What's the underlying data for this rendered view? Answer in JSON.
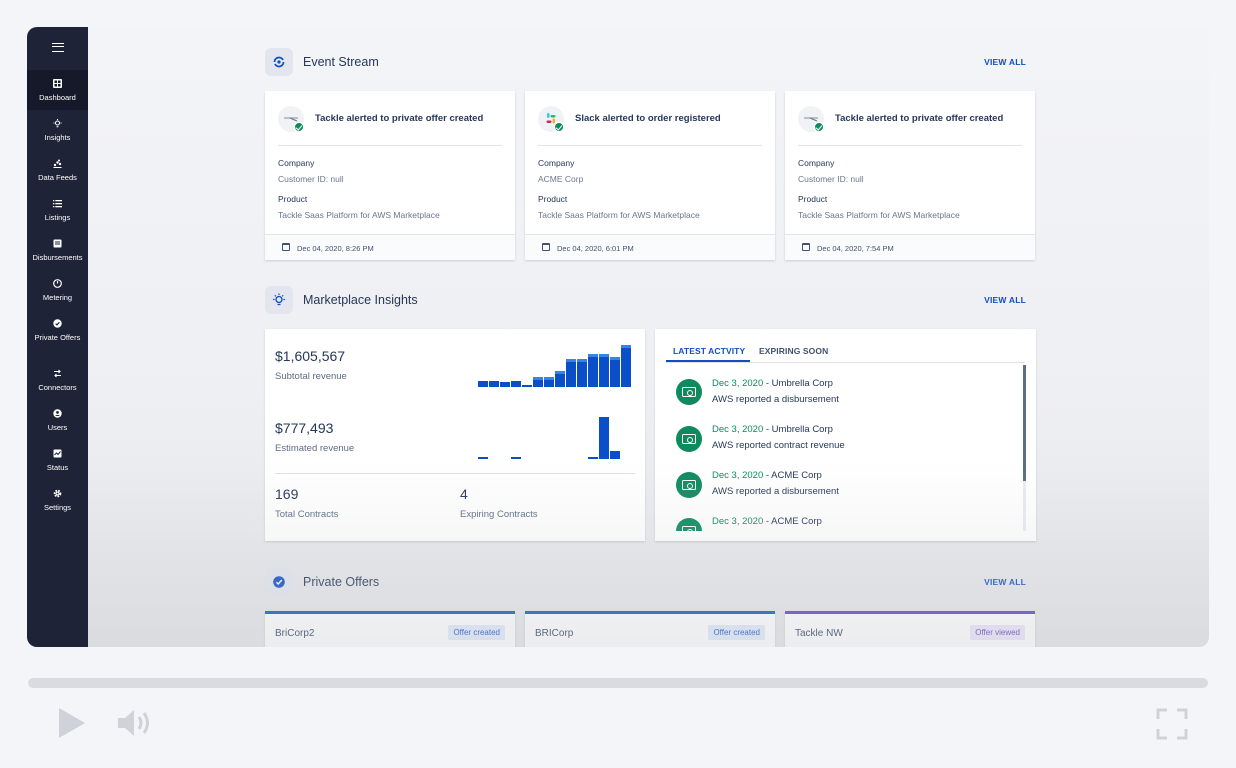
{
  "sidebar": {
    "items": [
      {
        "label": "Dashboard",
        "icon": "dashboard-icon"
      },
      {
        "label": "Insights",
        "icon": "lightbulb-icon"
      },
      {
        "label": "Data Feeds",
        "icon": "data-feeds-icon"
      },
      {
        "label": "Listings",
        "icon": "list-icon"
      },
      {
        "label": "Disbursements",
        "icon": "receipt-icon"
      },
      {
        "label": "Metering",
        "icon": "meter-icon"
      },
      {
        "label": "Private Offers",
        "icon": "badge-icon"
      },
      {
        "label": "Connectors",
        "icon": "connector-icon"
      },
      {
        "label": "Users",
        "icon": "user-icon"
      },
      {
        "label": "Status",
        "icon": "status-icon"
      },
      {
        "label": "Settings",
        "icon": "gear-icon"
      }
    ]
  },
  "event_stream": {
    "title": "Event Stream",
    "view_all": "VIEW ALL",
    "cards": [
      {
        "title": "Tackle alerted to private offer created",
        "company_label": "Company",
        "company": "Customer ID: null",
        "product_label": "Product",
        "product": "Tackle Saas Platform for AWS Marketplace",
        "date": "Dec 04, 2020, 8:26 PM",
        "logo": "tackle-logo"
      },
      {
        "title": "Slack alerted to order registered",
        "company_label": "Company",
        "company": "ACME Corp",
        "product_label": "Product",
        "product": "Tackle Saas Platform for AWS Marketplace",
        "date": "Dec 04, 2020, 6:01 PM",
        "logo": "slack-logo"
      },
      {
        "title": "Tackle alerted to private offer created",
        "company_label": "Company",
        "company": "Customer ID: null",
        "product_label": "Product",
        "product": "Tackle Saas Platform for AWS Marketplace",
        "date": "Dec 04, 2020, 7:54 PM",
        "logo": "tackle-logo"
      }
    ]
  },
  "insights": {
    "title": "Marketplace Insights",
    "view_all": "VIEW ALL",
    "subtotal_value": "$1,605,567",
    "subtotal_label": "Subtotal revenue",
    "estimated_value": "$777,493",
    "estimated_label": "Estimated revenue",
    "total_contracts_value": "169",
    "total_contracts_label": "Total Contracts",
    "expiring_value": "4",
    "expiring_label": "Expiring Contracts",
    "subtotal_sparkline": [
      0.15,
      0.15,
      0.12,
      0.15,
      0.03,
      0.24,
      0.24,
      0.38,
      0.67,
      0.67,
      0.79,
      0.79,
      0.71,
      1.0
    ],
    "estimated_sparkline": [
      0.05,
      0,
      0,
      0.05,
      0,
      0,
      0,
      0,
      0,
      0,
      0.05,
      1.0,
      0.19
    ],
    "accent_color": "#0a4fc7"
  },
  "activity": {
    "tabs": [
      "LATEST ACTVITY",
      "EXPIRING SOON"
    ],
    "items": [
      {
        "date": "Dec 3, 2020",
        "company": " - Umbrella Corp",
        "text": "AWS reported a disbursement"
      },
      {
        "date": "Dec 3, 2020",
        "company": " - Umbrella Corp",
        "text": "AWS reported contract revenue"
      },
      {
        "date": "Dec 3, 2020",
        "company": " - ACME Corp",
        "text": "AWS reported a disbursement"
      },
      {
        "date": "Dec 3, 2020",
        "company": " - ACME Corp",
        "text": ""
      }
    ]
  },
  "private_offers": {
    "title": "Private Offers",
    "view_all": "VIEW ALL",
    "cards": [
      {
        "name": "BriCorp2",
        "status": "Offer created",
        "color": "#0a4fc7"
      },
      {
        "name": "BRICorp",
        "status": "Offer created",
        "color": "#0a4fc7"
      },
      {
        "name": "Tackle NW",
        "status": "Offer viewed",
        "color": "#5b3fb8"
      }
    ]
  },
  "player": {
    "progress": 0
  }
}
